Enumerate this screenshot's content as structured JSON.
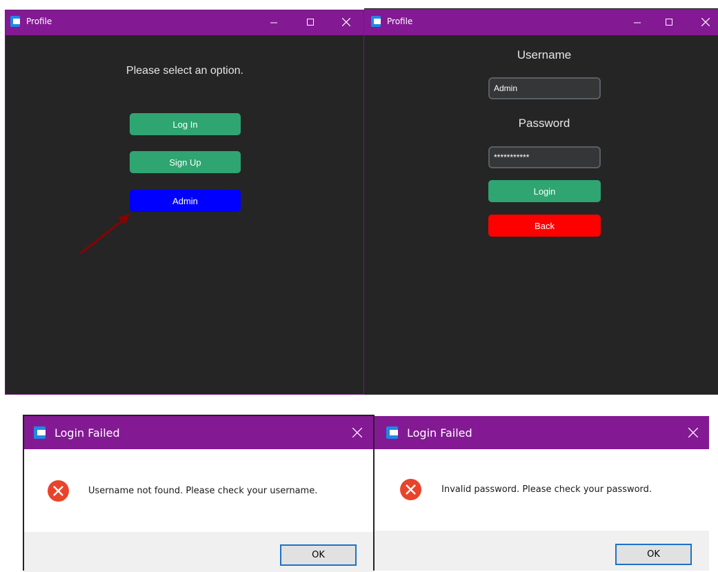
{
  "window1": {
    "title": "Profile",
    "prompt": "Please select an option.",
    "buttons": {
      "login": "Log In",
      "signup": "Sign Up",
      "admin": "Admin"
    },
    "colors": {
      "titlebar": "#841994",
      "background": "#252525",
      "green": "#2fa571",
      "admin": "#0000ff",
      "arrow": "#8b0000"
    }
  },
  "window2": {
    "title": "Profile",
    "username_label": "Username",
    "username_value": "Admin",
    "password_label": "Password",
    "password_value": "***********",
    "buttons": {
      "login": "Login",
      "back": "Back"
    },
    "colors": {
      "back": "#ff0000"
    }
  },
  "dialog1": {
    "title": "Login Failed",
    "message": "Username not found. Please check your username.",
    "ok": "OK"
  },
  "dialog2": {
    "title": "Login Failed",
    "message": "Invalid password. Please check your password.",
    "ok": "OK"
  },
  "icons": {
    "window": "app-icon",
    "minimize": "minimize-icon",
    "maximize": "maximize-icon",
    "close": "close-icon",
    "error": "error-icon"
  }
}
